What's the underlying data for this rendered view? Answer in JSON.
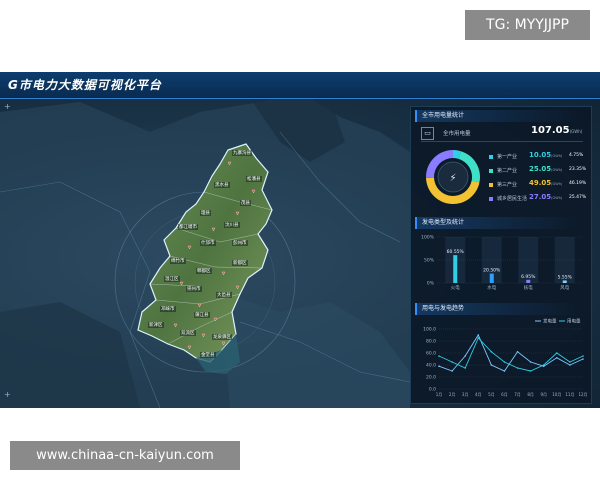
{
  "watermark_tg": "TG: MYYJJPP",
  "watermark_site": "www.chinaa-cn-kaiyun.com",
  "dashboard_title": "G市电力大数据可视化平台",
  "panel1": {
    "title": "全市用电量统计",
    "total_label": "全市用电量",
    "total_value": "107.05",
    "total_unit": "(GWh)",
    "items": [
      {
        "name": "第一产业",
        "value": "10.05",
        "unit": "(GWh)",
        "percent": "4.75%",
        "color": "#2fd0e6",
        "share": 4.75
      },
      {
        "name": "第二产业",
        "value": "25.05",
        "unit": "(GWh)",
        "percent": "23.35%",
        "color": "#3fe0c8",
        "share": 23.35
      },
      {
        "name": "第三产业",
        "value": "49.05",
        "unit": "(GWh)",
        "percent": "46.19%",
        "color": "#f2c232",
        "share": 46.19
      },
      {
        "name": "城乡居民生活",
        "value": "27.05",
        "unit": "(GWh)",
        "percent": "25.47%",
        "color": "#8a7cff",
        "share": 25.47
      }
    ]
  },
  "chart_data": [
    {
      "type": "bar",
      "title": "发电类型及统计",
      "categories": [
        "火电",
        "水电",
        "核电",
        "风电"
      ],
      "values": [
        60.55,
        20.5,
        6.95,
        5.55
      ],
      "data_labels": [
        "60.55%",
        "20.50%",
        "6.95%",
        "5.55%"
      ],
      "yticks": [
        "100%",
        "50%",
        "0%"
      ],
      "ylim": [
        0,
        100
      ],
      "colors": [
        "#2fd0e6",
        "#2f9fff",
        "#8a7cff",
        "#7fd0ff"
      ]
    },
    {
      "type": "line",
      "title": "用电与发电趋势",
      "categories": [
        "1月",
        "2月",
        "3月",
        "4月",
        "5月",
        "6月",
        "7月",
        "8月",
        "9月",
        "10月",
        "11月",
        "12月"
      ],
      "yticks": [
        "100.0",
        "80.0",
        "60.0",
        "40.0",
        "20.0",
        "0.0"
      ],
      "ylim": [
        0,
        100
      ],
      "series": [
        {
          "name": "发电量",
          "color": "#7fc8ff",
          "values": [
            38,
            30,
            55,
            90,
            40,
            30,
            62,
            45,
            38,
            52,
            40,
            50
          ]
        },
        {
          "name": "用电量",
          "color": "#2fd0e6",
          "values": [
            55,
            45,
            35,
            85,
            62,
            45,
            35,
            30,
            40,
            60,
            45,
            55
          ]
        }
      ]
    }
  ],
  "map": {
    "labels": [
      "九寨沟县",
      "松潘县",
      "黑水县",
      "茂县",
      "理县",
      "汶川县",
      "都江堰市",
      "彭州市",
      "什邡市",
      "绵竹市",
      "新都区",
      "郫都区",
      "温江区",
      "崇州市",
      "大邑县",
      "邛崃市",
      "蒲江县",
      "新津区",
      "双流区",
      "龙泉驿区",
      "金堂县"
    ]
  }
}
